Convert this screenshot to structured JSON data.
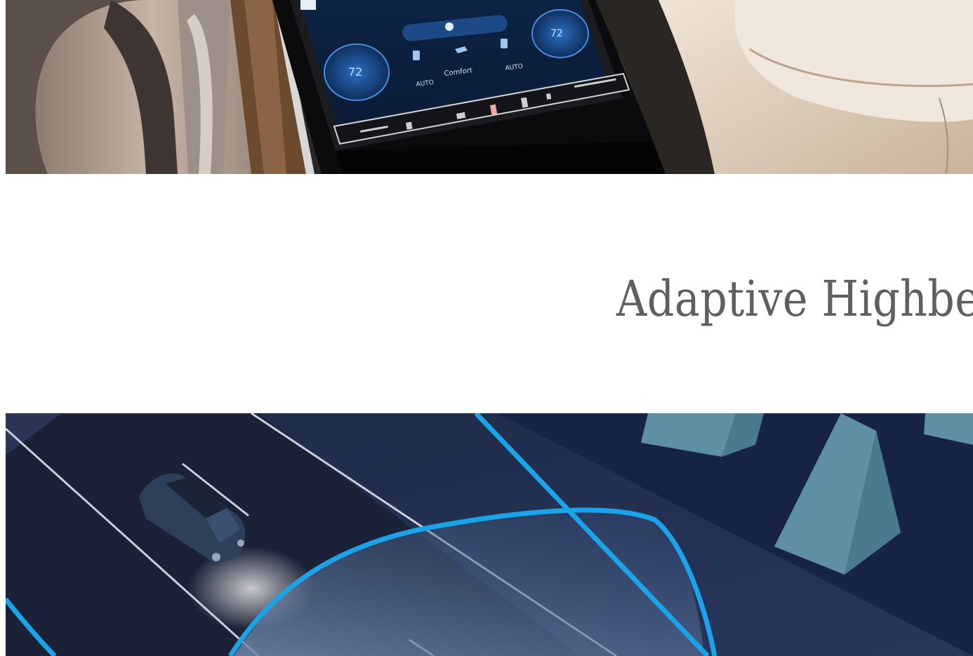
{
  "sections": [
    {
      "image": {
        "alt": "Mercedes-Benz interior with central touchscreen",
        "subject": "interior-dashboard"
      }
    },
    {
      "title": "Adaptive Highbea",
      "image": {
        "alt": "Adaptive Highbeam illustration with vehicles on a road at night",
        "subject": "adaptive-highbeam-road"
      }
    }
  ],
  "screen": {
    "temp_left": "72",
    "temp_right": "72",
    "label_center": "Comfort",
    "label_auto_left": "AUTO",
    "label_auto_right": "AUTO"
  },
  "colors": {
    "title": "#5f5f5f",
    "accent_cyan": "#1aa3e8",
    "road_dark": "#1b2a4d",
    "beige_interior": "#d9c7b2"
  }
}
